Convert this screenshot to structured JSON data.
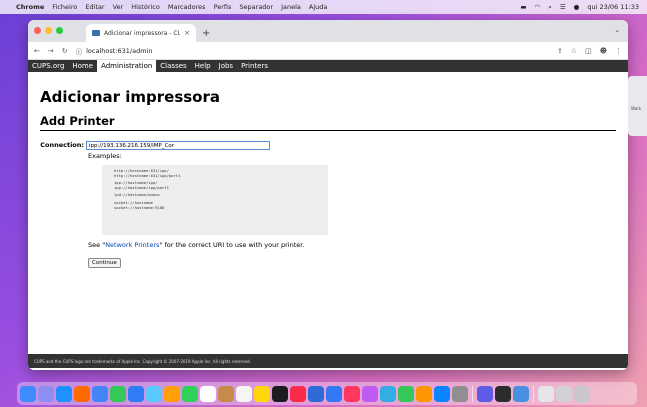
{
  "menubar": {
    "app": "Chrome",
    "items": [
      "Ficheiro",
      "Editar",
      "Ver",
      "Histórico",
      "Marcadores",
      "Perfis",
      "Separador",
      "Janela",
      "Ajuda"
    ],
    "clock": "qui 23/06 11:33"
  },
  "browser": {
    "tab_title": "Adicionar impressora - CUPS",
    "url": "localhost:631/admin"
  },
  "cups_nav": [
    "CUPS.org",
    "Home",
    "Administration",
    "Classes",
    "Help",
    "Jobs",
    "Printers"
  ],
  "page": {
    "title": "Adicionar impressora",
    "heading": "Add Printer",
    "connection_label": "Connection:",
    "connection_value": "ipp://193.136.216.159/IMP_Cor",
    "examples_label": "Examples:",
    "examples": [
      [
        "http://hostname:631/ipp/",
        "http://hostname:631/ipp/port1"
      ],
      [
        "ipp://hostname/ipp/",
        "ipp://hostname/ipp/port1"
      ],
      [
        "lpd://hostname/queue"
      ],
      [
        "socket://hostname",
        "socket://hostname:9100"
      ]
    ],
    "see_prefix": "See \"",
    "see_link": "Network Printers",
    "see_suffix": "\" for the correct URI to use with your printer.",
    "continue_label": "Continue",
    "footer": "CUPS and the CUPS logo are trademarks of Apple Inc. Copyright © 2007-2019 Apple Inc. All rights reserved."
  },
  "side_peek": "Work"
}
